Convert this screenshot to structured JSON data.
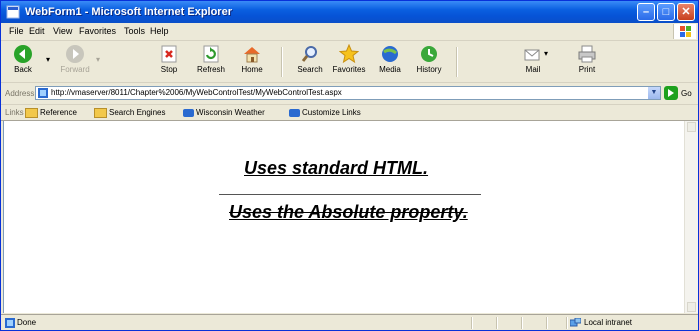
{
  "window": {
    "title": "WebForm1 - Microsoft Internet Explorer"
  },
  "menu": {
    "items": [
      "File",
      "Edit",
      "View",
      "Favorites",
      "Tools",
      "Help"
    ]
  },
  "toolbar": {
    "back": "Back",
    "forward": "Forward",
    "stop": "Stop",
    "refresh": "Refresh",
    "home": "Home",
    "search": "Search",
    "favorites": "Favorites",
    "media": "Media",
    "history": "History",
    "mail": "Mail",
    "print": "Print"
  },
  "address": {
    "label": "Address",
    "url": "http://vmaserver/8011/Chapter%2006/MyWebControlTest/MyWebControlTest.aspx",
    "go_label": "Go"
  },
  "links": {
    "label": "Links",
    "items": [
      "Reference",
      "Search Engines",
      "Wisconsin Weather",
      "Customize Links"
    ]
  },
  "content": {
    "heading1": "Uses standard HTML.",
    "heading2": "Uses the Absolute property."
  },
  "status": {
    "text": "Done",
    "zone": "Local intranet"
  }
}
